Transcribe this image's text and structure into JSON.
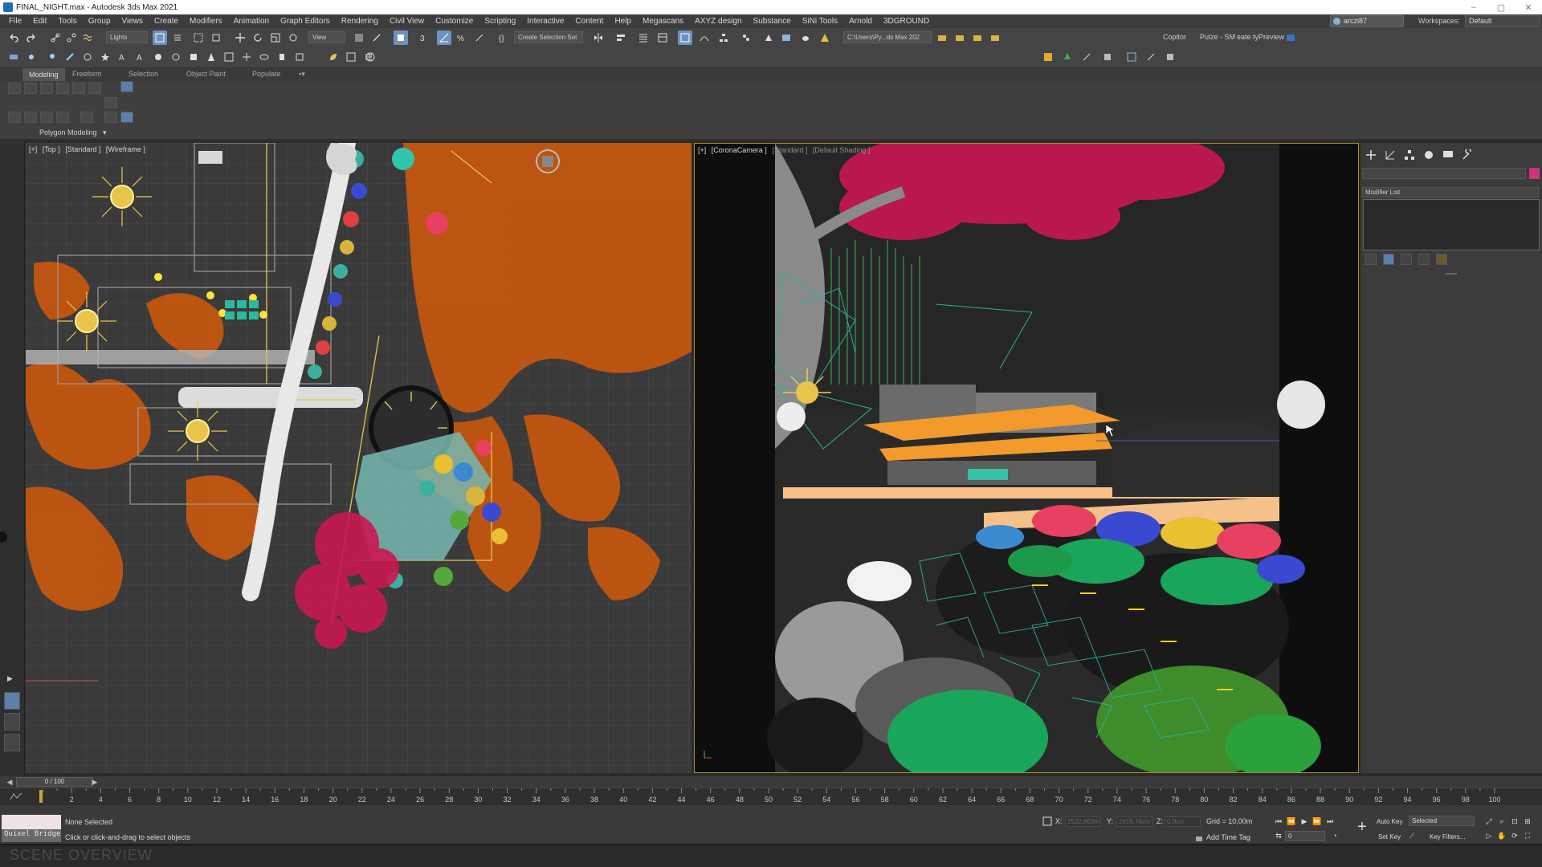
{
  "window": {
    "title": "FINAL_NIGHT.max - Autodesk 3ds Max 2021"
  },
  "menu": [
    "File",
    "Edit",
    "Tools",
    "Group",
    "Views",
    "Create",
    "Modifiers",
    "Animation",
    "Graph Editors",
    "Rendering",
    "Civil View",
    "Customize",
    "Scripting",
    "Interactive",
    "Content",
    "Help",
    "Megascans",
    "AXYZ design",
    "Substance",
    "SiNi Tools",
    "Arnold",
    "3DGROUND"
  ],
  "account": {
    "user": "arczi87",
    "workspaces_label": "Workspaces:",
    "workspace": "Default"
  },
  "toolbar": {
    "selection_filter": "Lights",
    "ref_coord": "View",
    "named_selection": "Create Selection Set",
    "project_path": "C:\\Users\\Py...ds Max 202",
    "copitor": "Copitor",
    "pulze": "Pulze - SM",
    "preview": "eate tyPreview"
  },
  "ribbon": {
    "tabs": [
      "Modeling",
      "Freeform",
      "Selection",
      "Object Paint",
      "Populate"
    ],
    "active_tab": "Modeling",
    "panel_label": "Polygon Modeling"
  },
  "viewports": {
    "top": {
      "labels": [
        "[+]",
        "[Top ]",
        "[Standard ]",
        "[Wireframe ]"
      ]
    },
    "camera": {
      "labels": [
        "[+]",
        "[CoronaCamera ]",
        "[Standard ]",
        "[Default Shading ]"
      ]
    }
  },
  "command_panel": {
    "modifier_list": "Modifier List",
    "color": "#c8357e"
  },
  "timeline": {
    "frame_display": "0 / 100",
    "ticks": [
      0,
      2,
      4,
      6,
      8,
      10,
      12,
      14,
      16,
      18,
      20,
      22,
      24,
      26,
      28,
      30,
      32,
      34,
      36,
      38,
      40,
      42,
      44,
      46,
      48,
      50,
      52,
      54,
      56,
      58,
      60,
      62,
      64,
      66,
      68,
      70,
      72,
      74,
      76,
      78,
      80,
      82,
      84,
      86,
      88,
      90,
      92,
      94,
      96,
      98,
      100
    ]
  },
  "status": {
    "maxscript_text": "Quixel Bridge",
    "selection": "None Selected",
    "prompt": "Click or click-and-drag to select objects",
    "x_label": "X:",
    "x_value": "2532,863m",
    "y_label": "Y:",
    "y_value": "2616,78cm",
    "z_label": "Z:",
    "z_value": "0,0cm",
    "grid": "Grid = 10,00m",
    "add_time_tag": "Add Time Tag",
    "auto_key": "Auto Key",
    "set_key": "Set Key",
    "key_mode": "Selected",
    "key_filters": "Key Filters...",
    "current_frame": "0"
  },
  "caption": "SCENE OVERVIEW"
}
